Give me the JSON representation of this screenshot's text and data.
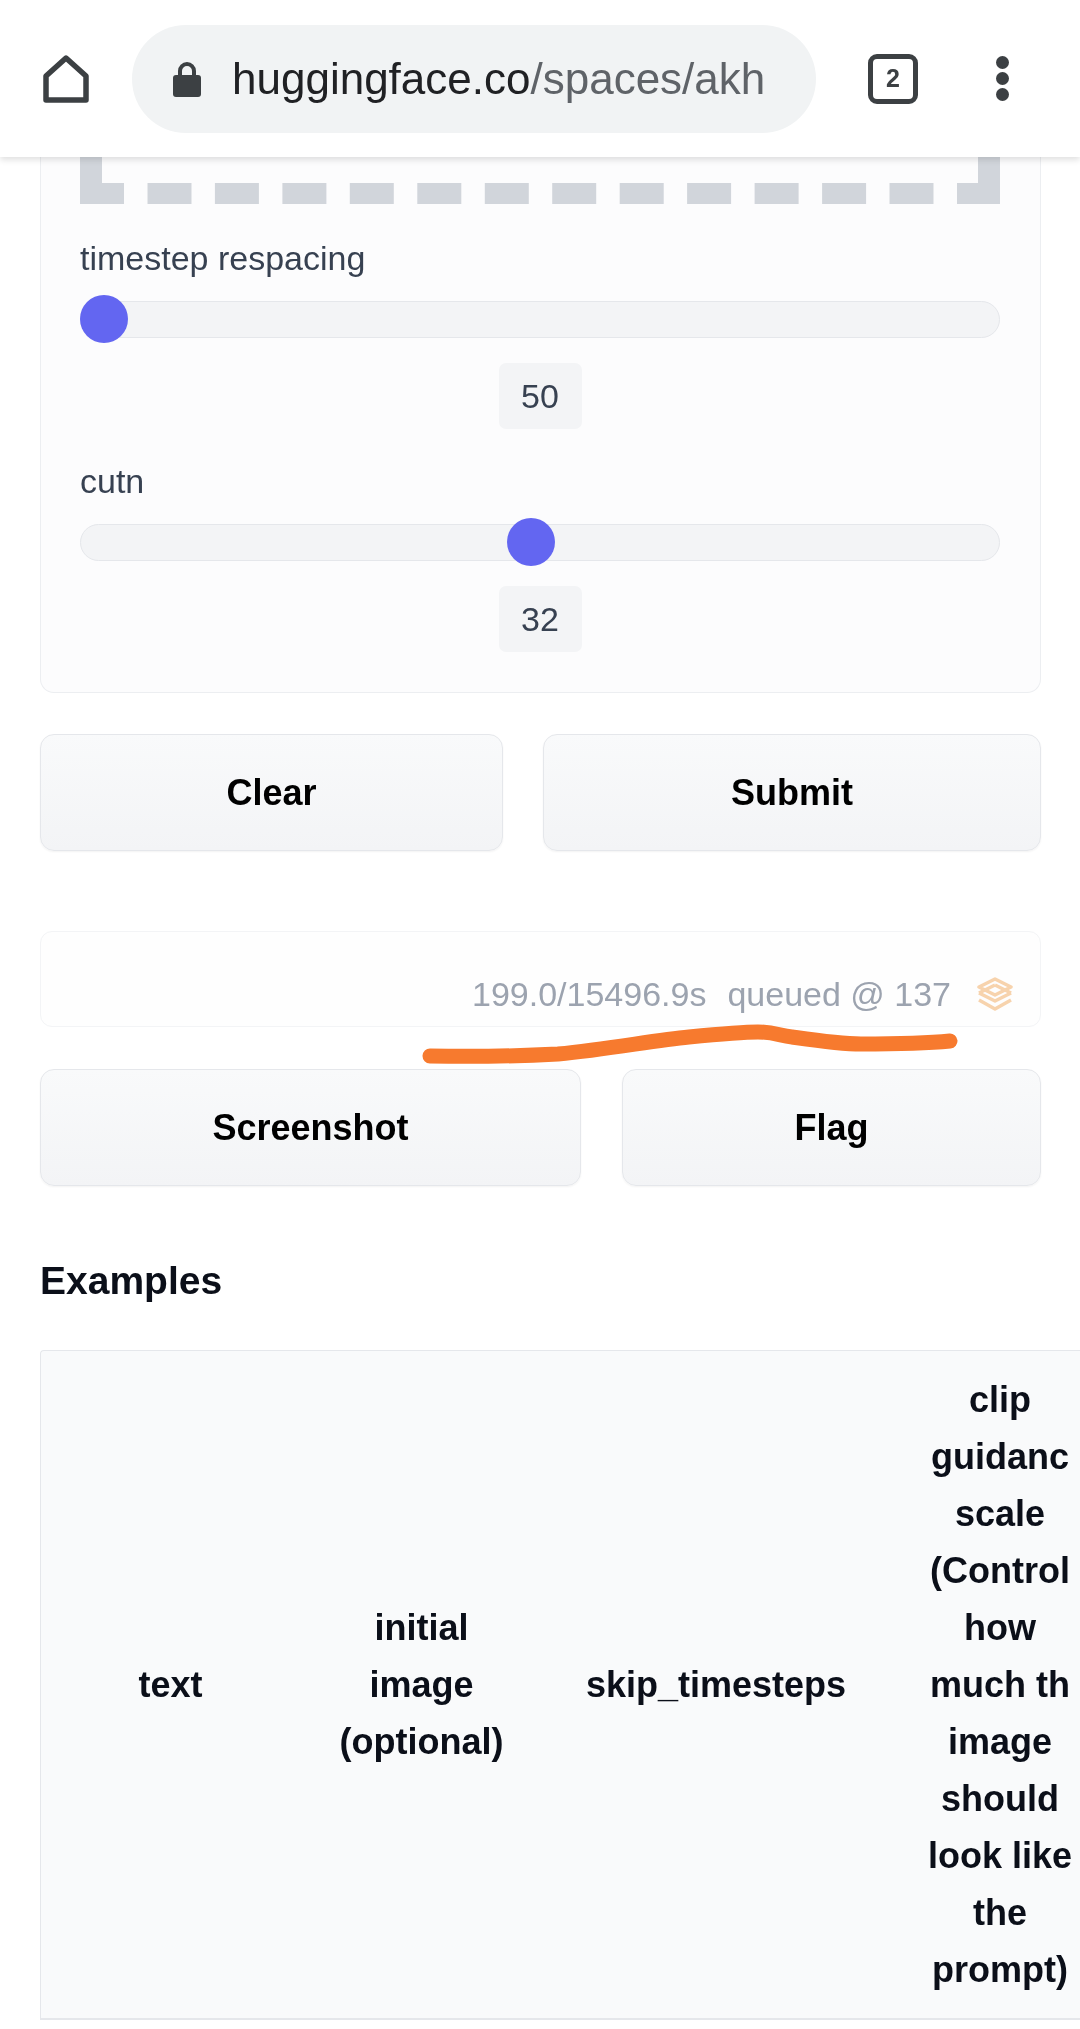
{
  "browser": {
    "address_bar": {
      "host": "huggingface.co",
      "path": "/spaces/akh"
    },
    "tab_count": "2"
  },
  "sliders": [
    {
      "label": "timestep respacing",
      "level": 0,
      "value": "50"
    },
    {
      "label": "cutn",
      "level": 0.49,
      "value": "32"
    }
  ],
  "buttons": [
    "Clear",
    "Submit"
  ],
  "status": {
    "elapsed": "199.0/15496.9s",
    "queue": "queued @ 137"
  },
  "flag_buttons": [
    "Screenshot",
    "Flag"
  ],
  "examples": {
    "title": "Examples",
    "columns": [
      "text",
      "initial image (optional)",
      "skip_timesteps",
      "clip guidanc scale (Control how much th image should look like the prompt)"
    ]
  }
}
